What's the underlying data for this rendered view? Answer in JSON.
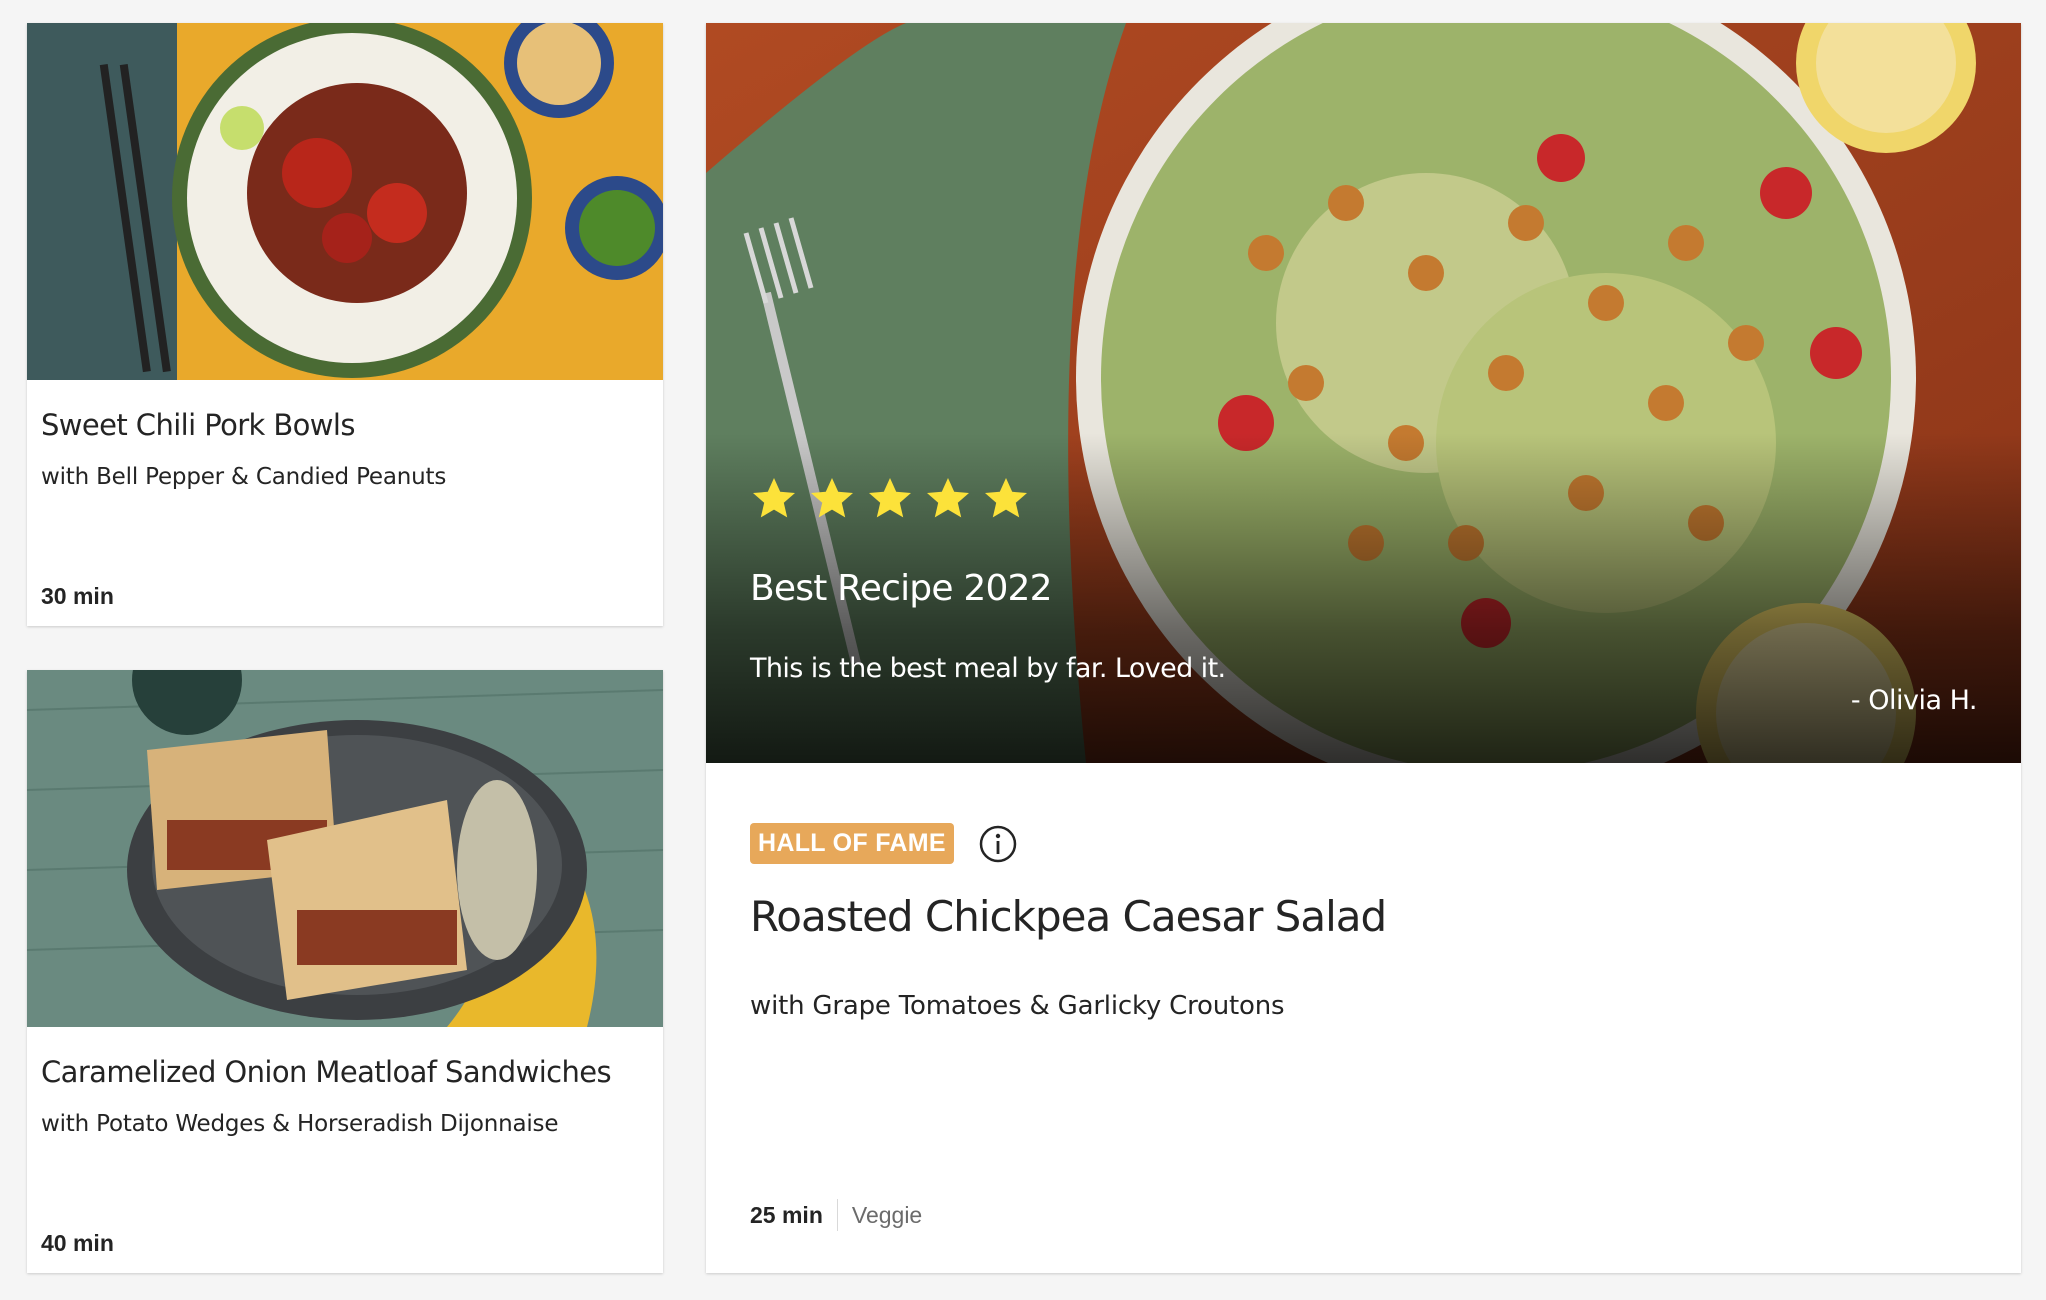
{
  "cards": [
    {
      "title": "Sweet Chili Pork Bowls",
      "subtitle": "with Bell Pepper & Candied Peanuts",
      "time": "30 min"
    },
    {
      "title": "Caramelized Onion Meatloaf Sandwiches",
      "subtitle": "with Potato Wedges & Horseradish Dijonnaise",
      "time": "40 min"
    }
  ],
  "featured": {
    "rating": 5,
    "review_title": "Best Recipe 2022",
    "review_text": "This is the best meal by far. Loved it.",
    "review_author": "- Olivia H.",
    "badge": "HALL OF FAME",
    "title": "Roasted Chickpea Caesar Salad",
    "subtitle": "with Grape Tomatoes & Garlicky Croutons",
    "time": "25 min",
    "tag": "Veggie"
  },
  "colors": {
    "badge": "#e7a85a",
    "star": "#fce23a",
    "page_bg": "#f5f5f5"
  },
  "icons": [
    "star-icon",
    "info-icon"
  ]
}
